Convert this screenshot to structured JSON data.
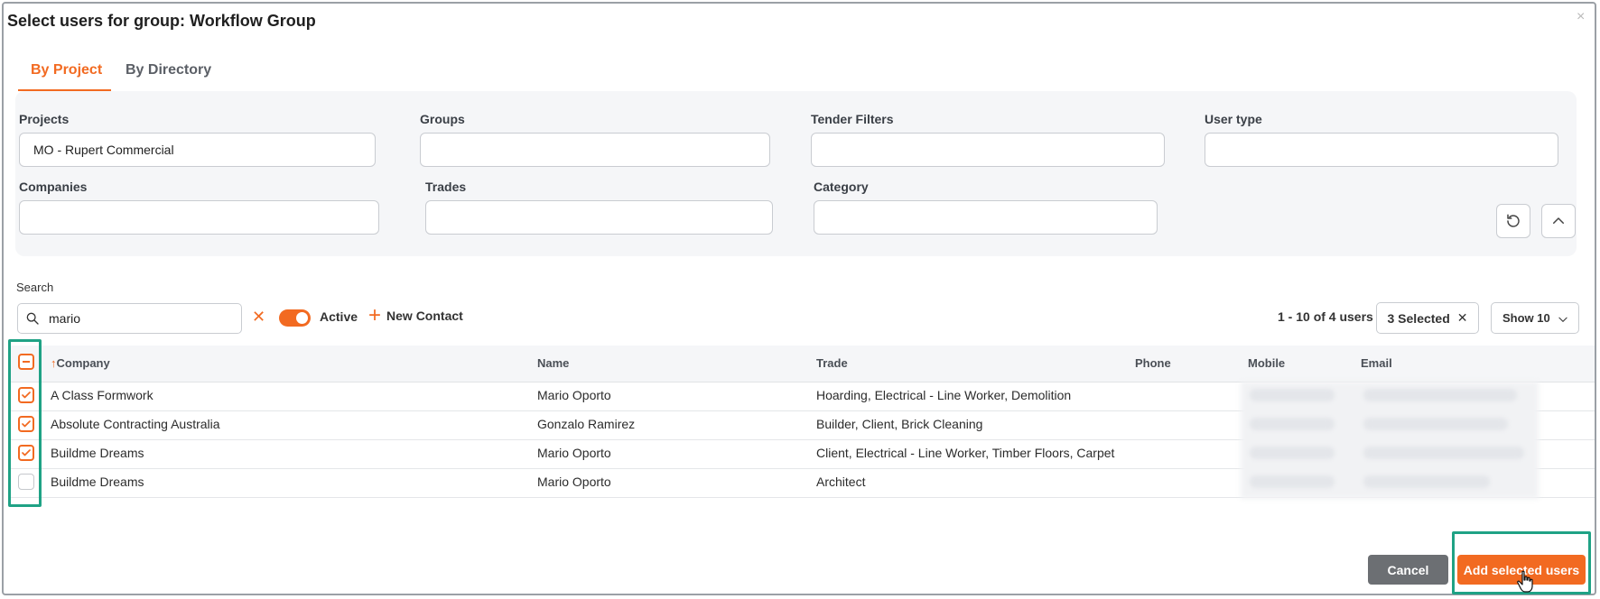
{
  "dialog": {
    "title": "Select users for group: Workflow Group",
    "close_glyph": "×"
  },
  "tabs": [
    {
      "label": "By Project",
      "active": true
    },
    {
      "label": "By Directory",
      "active": false
    }
  ],
  "filters": {
    "projects": {
      "label": "Projects",
      "value": "MO - Rupert Commercial"
    },
    "groups": {
      "label": "Groups",
      "value": ""
    },
    "tender_filters": {
      "label": "Tender Filters",
      "value": ""
    },
    "user_type": {
      "label": "User type",
      "value": ""
    },
    "companies": {
      "label": "Companies",
      "value": ""
    },
    "trades": {
      "label": "Trades",
      "value": ""
    },
    "category": {
      "label": "Category",
      "value": ""
    }
  },
  "search": {
    "label": "Search",
    "value": "mario",
    "clear_glyph": "✕"
  },
  "toolbar": {
    "active_label": "Active",
    "active_on": true,
    "new_contact_label": "New Contact",
    "new_contact_glyph": "+",
    "pager_text": "1 - 10 of 4 users",
    "selected_label": "3 Selected",
    "selected_clear_glyph": "✕",
    "show_label": "Show 10"
  },
  "table": {
    "sort_arrow": "↑",
    "columns": [
      "Company",
      "Name",
      "Trade",
      "Phone",
      "Mobile",
      "Email"
    ],
    "rows": [
      {
        "checked": true,
        "company": "A Class Formwork",
        "name": "Mario Oporto",
        "trade": "Hoarding, Electrical - Line Worker, Demolition"
      },
      {
        "checked": true,
        "company": "Absolute Contracting Australia",
        "name": "Gonzalo Ramirez",
        "trade": "Builder, Client, Brick Cleaning"
      },
      {
        "checked": true,
        "company": "Buildme Dreams",
        "name": "Mario Oporto",
        "trade": "Client, Electrical - Line Worker, Timber Floors, Carpet"
      },
      {
        "checked": false,
        "company": "Buildme Dreams",
        "name": "Mario Oporto",
        "trade": "Architect"
      }
    ]
  },
  "footer": {
    "cancel_label": "Cancel",
    "add_label": "Add selected users"
  },
  "colors": {
    "accent": "#f26a21",
    "highlight": "#1fa285",
    "cancel": "#6c6f73"
  }
}
